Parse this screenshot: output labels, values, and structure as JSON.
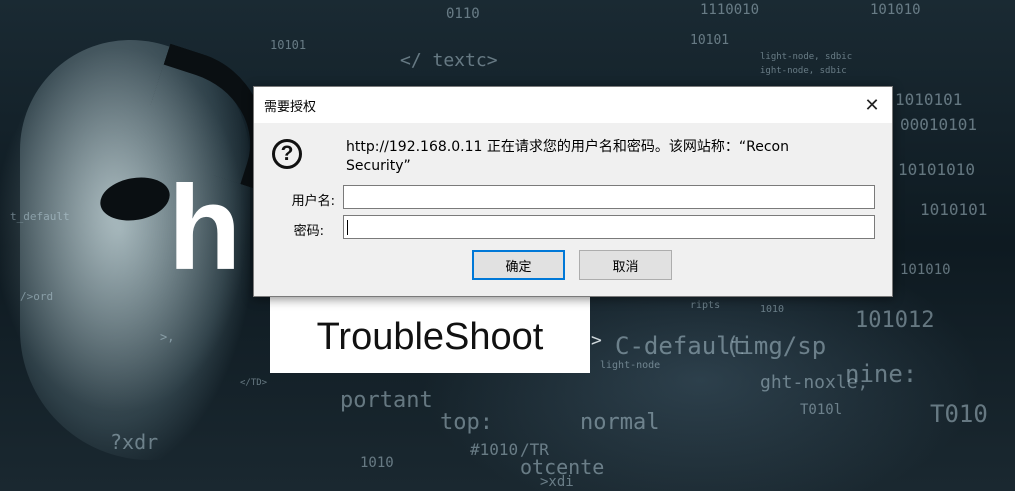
{
  "background": {
    "logo_letter": "h",
    "site_title": "TroubleShoot",
    "code_snippets": [
      "0110",
      "1110010",
      "101010",
      "10101",
      "10101",
      "</ textc>",
      "light-node, sdbic",
      "ight-node, sdbic",
      "1010101",
      "00010101",
      "10101010",
      "1010101",
      "101010",
      "t_default",
      "/>ord",
      ">,",
      "ripts",
      "1010",
      "light-node",
      "</TD>",
      "portant",
      "top:",
      "normal",
      "otcente",
      ">xdi",
      "C-default",
      "(img/sp",
      "ght-noxle,",
      "nine:",
      "T010",
      "/TR",
      "?xdr",
      "101012",
      "#1010",
      "1010",
      "T010l"
    ],
    "arrow": ">"
  },
  "dialog": {
    "title": "需要授权",
    "close_glyph": "✕",
    "question_glyph": "?",
    "message": "http://192.168.0.11 正在请求您的用户名和密码。该网站称：“Recon Security”",
    "username_label": "用户名:",
    "username_value": "",
    "password_label": "密码:",
    "password_value": "",
    "ok_label": "确定",
    "cancel_label": "取消"
  }
}
